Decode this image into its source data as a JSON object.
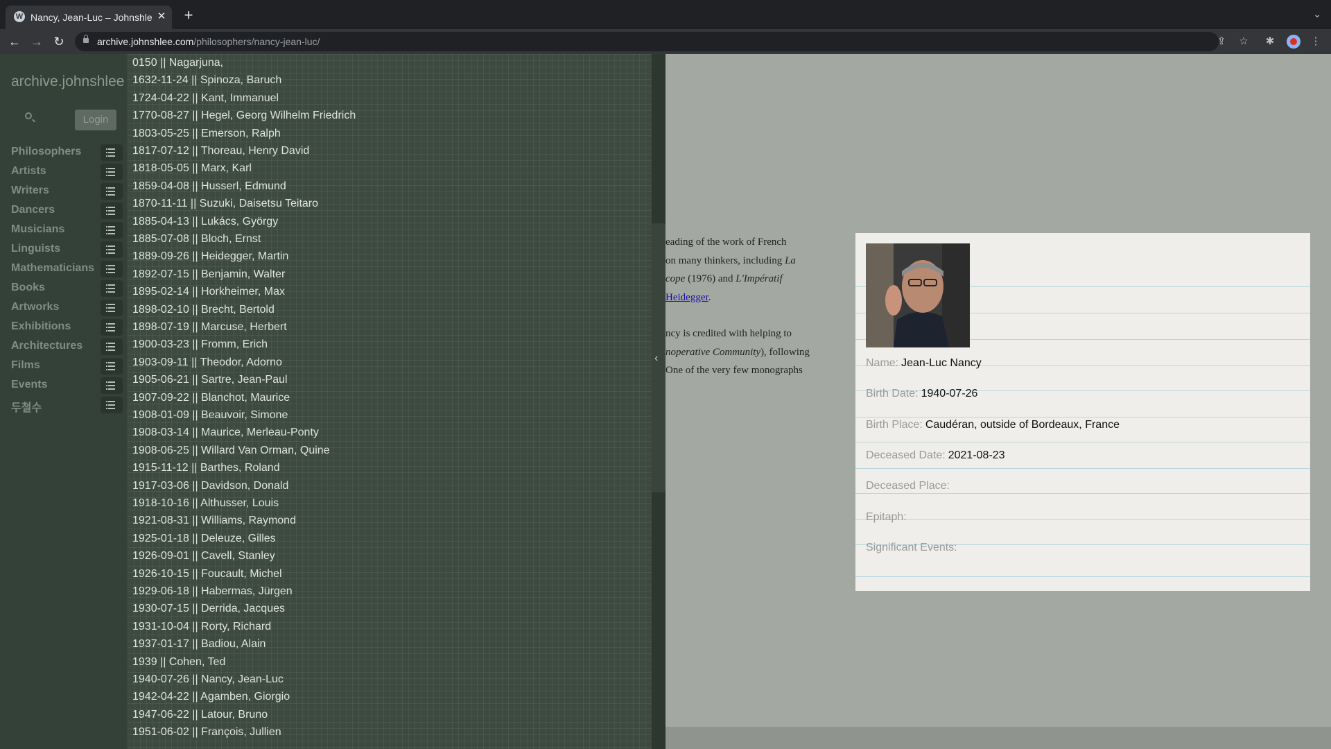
{
  "browser": {
    "tab_title": "Nancy, Jean-Luc – Johnshlee Archive",
    "url_host": "archive.johnshlee.com",
    "url_path": "/philosophers/nancy-jean-luc/"
  },
  "sidebar": {
    "brand": "archive.johnshlee",
    "login_label": "Login",
    "items": [
      {
        "label": "Philosophers"
      },
      {
        "label": "Artists"
      },
      {
        "label": "Writers"
      },
      {
        "label": "Dancers"
      },
      {
        "label": "Musicians"
      },
      {
        "label": "Linguists"
      },
      {
        "label": "Mathematicians"
      },
      {
        "label": "Books"
      },
      {
        "label": "Artworks"
      },
      {
        "label": "Exhibitions"
      },
      {
        "label": "Architectures"
      },
      {
        "label": "Films"
      },
      {
        "label": "Events"
      },
      {
        "label": "두철수"
      }
    ]
  },
  "dropdown": {
    "items": [
      "0150 || Nagarjuna,",
      "1632-11-24 || Spinoza, Baruch",
      "1724-04-22 || Kant, Immanuel",
      "1770-08-27 || Hegel, Georg Wilhelm Friedrich",
      "1803-05-25 || Emerson, Ralph",
      "1817-07-12 || Thoreau, Henry David",
      "1818-05-05 || Marx, Karl",
      "1859-04-08 || Husserl, Edmund",
      "1870-11-11 || Suzuki, Daisetsu Teitaro",
      "1885-04-13 || Lukács, György",
      "1885-07-08 || Bloch, Ernst",
      "1889-09-26 || Heidegger, Martin",
      "1892-07-15 || Benjamin, Walter",
      "1895-02-14 || Horkheimer, Max",
      "1898-02-10 || Brecht, Bertold",
      "1898-07-19 || Marcuse, Herbert",
      "1900-03-23 || Fromm, Erich",
      "1903-09-11 || Theodor, Adorno",
      "1905-06-21 || Sartre, Jean-Paul",
      "1907-09-22 || Blanchot, Maurice",
      "1908-01-09 || Beauvoir, Simone",
      "1908-03-14 || Maurice, Merleau-Ponty",
      "1908-06-25 || Willard Van Orman, Quine",
      "1915-11-12 || Barthes, Roland",
      "1917-03-06 || Davidson, Donald",
      "1918-10-16 || Althusser, Louis",
      "1921-08-31 || Williams, Raymond",
      "1925-01-18 || Deleuze, Gilles",
      "1926-09-01 || Cavell, Stanley",
      "1926-10-15 || Foucault, Michel",
      "1929-06-18 || Habermas, Jürgen",
      "1930-07-15 || Derrida, Jacques",
      "1931-10-04 || Rorty, Richard",
      "1937-01-17 || Badiou, Alain",
      "1939 || Cohen, Ted",
      "1940-07-26 || Nancy, Jean-Luc",
      "1942-04-22 || Agamben, Giorgio",
      "1947-06-22 || Latour, Bruno",
      "1951-06-02 || François, Jullien"
    ]
  },
  "article": {
    "line1": "eading of the work of French",
    "line2a": " on many thinkers, including ",
    "line2b": "La",
    "line3a": "cope",
    "line3b": " (1976) and ",
    "line3c": "L'Impératif",
    "line4_link": "Heidegger",
    "line4_end": ".",
    "line5": "ncy is credited with helping to",
    "line6a": "noperative Community",
    "line6b": "), following",
    "line7": "One of the very few monographs"
  },
  "infobox": {
    "fields": [
      {
        "label": "Name:",
        "value": "Jean-Luc Nancy"
      },
      {
        "label": "Birth Date:",
        "value": "1940-07-26"
      },
      {
        "label": "Birth Place:",
        "value": "Caudéran, outside of Bordeaux, France"
      },
      {
        "label": "Deceased Date:",
        "value": "2021-08-23"
      },
      {
        "label": "Deceased Place:",
        "value": ""
      },
      {
        "label": "Epitaph:",
        "value": ""
      },
      {
        "label": "Significant Events:",
        "value": ""
      }
    ]
  }
}
